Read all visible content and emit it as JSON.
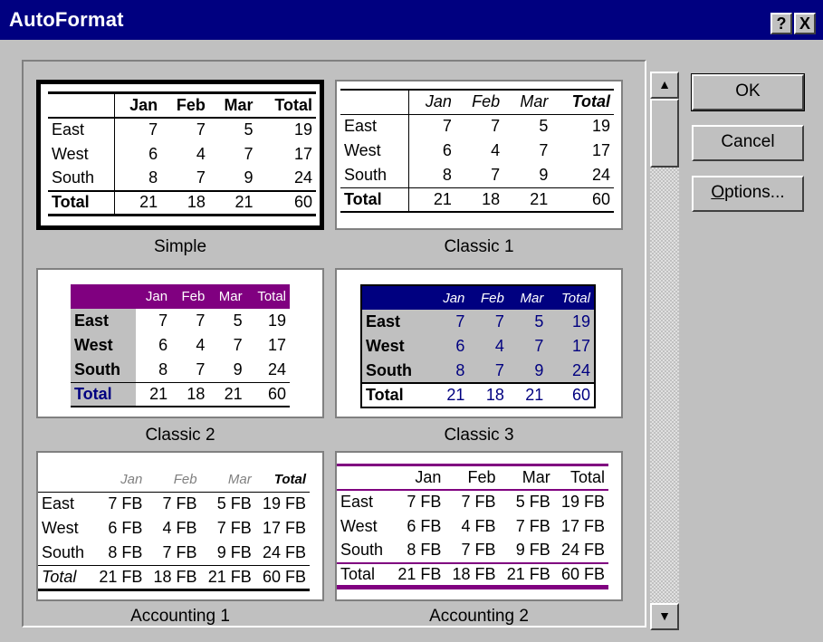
{
  "window": {
    "title": "AutoFormat",
    "help_label": "?",
    "close_label": "X"
  },
  "buttons": {
    "ok": "OK",
    "cancel": "Cancel",
    "options_prefix": "O",
    "options_rest": "ptions..."
  },
  "scrollbar": {
    "up": "▲",
    "down": "▼"
  },
  "formats": [
    {
      "name": "Simple",
      "columns": [
        "",
        "Jan",
        "Feb",
        "Mar",
        "Total"
      ],
      "rows": [
        [
          "East",
          "7",
          "7",
          "5",
          "19"
        ],
        [
          "West",
          "6",
          "4",
          "7",
          "17"
        ],
        [
          "South",
          "8",
          "7",
          "9",
          "24"
        ],
        [
          "Total",
          "21",
          "18",
          "21",
          "60"
        ]
      ]
    },
    {
      "name": "Classic 1",
      "columns": [
        "",
        "Jan",
        "Feb",
        "Mar",
        "Total"
      ],
      "rows": [
        [
          "East",
          "7",
          "7",
          "5",
          "19"
        ],
        [
          "West",
          "6",
          "4",
          "7",
          "17"
        ],
        [
          "South",
          "8",
          "7",
          "9",
          "24"
        ],
        [
          "Total",
          "21",
          "18",
          "21",
          "60"
        ]
      ]
    },
    {
      "name": "Classic 2",
      "columns": [
        "",
        "Jan",
        "Feb",
        "Mar",
        "Total"
      ],
      "rows": [
        [
          "East",
          "7",
          "7",
          "5",
          "19"
        ],
        [
          "West",
          "6",
          "4",
          "7",
          "17"
        ],
        [
          "South",
          "8",
          "7",
          "9",
          "24"
        ],
        [
          "Total",
          "21",
          "18",
          "21",
          "60"
        ]
      ]
    },
    {
      "name": "Classic 3",
      "columns": [
        "",
        "Jan",
        "Feb",
        "Mar",
        "Total"
      ],
      "rows": [
        [
          "East",
          "7",
          "7",
          "5",
          "19"
        ],
        [
          "West",
          "6",
          "4",
          "7",
          "17"
        ],
        [
          "South",
          "8",
          "7",
          "9",
          "24"
        ],
        [
          "Total",
          "21",
          "18",
          "21",
          "60"
        ]
      ]
    },
    {
      "name": "Accounting 1",
      "columns": [
        "",
        "Jan",
        "Feb",
        "Mar",
        "Total"
      ],
      "rows": [
        [
          "East",
          "7 FB",
          "7 FB",
          "5 FB",
          "19 FB"
        ],
        [
          "West",
          "6 FB",
          "4 FB",
          "7 FB",
          "17 FB"
        ],
        [
          "South",
          "8 FB",
          "7 FB",
          "9 FB",
          "24 FB"
        ],
        [
          "Total",
          "21 FB",
          "18 FB",
          "21 FB",
          "60 FB"
        ]
      ]
    },
    {
      "name": "Accounting 2",
      "columns": [
        "",
        "Jan",
        "Feb",
        "Mar",
        "Total"
      ],
      "rows": [
        [
          "East",
          "7 FB",
          "7 FB",
          "5 FB",
          "19 FB"
        ],
        [
          "West",
          "6 FB",
          "4 FB",
          "7 FB",
          "17 FB"
        ],
        [
          "South",
          "8 FB",
          "7 FB",
          "9 FB",
          "24 FB"
        ],
        [
          "Total",
          "21 FB",
          "18 FB",
          "21 FB",
          "60 FB"
        ]
      ]
    }
  ],
  "selected_format": "Simple"
}
